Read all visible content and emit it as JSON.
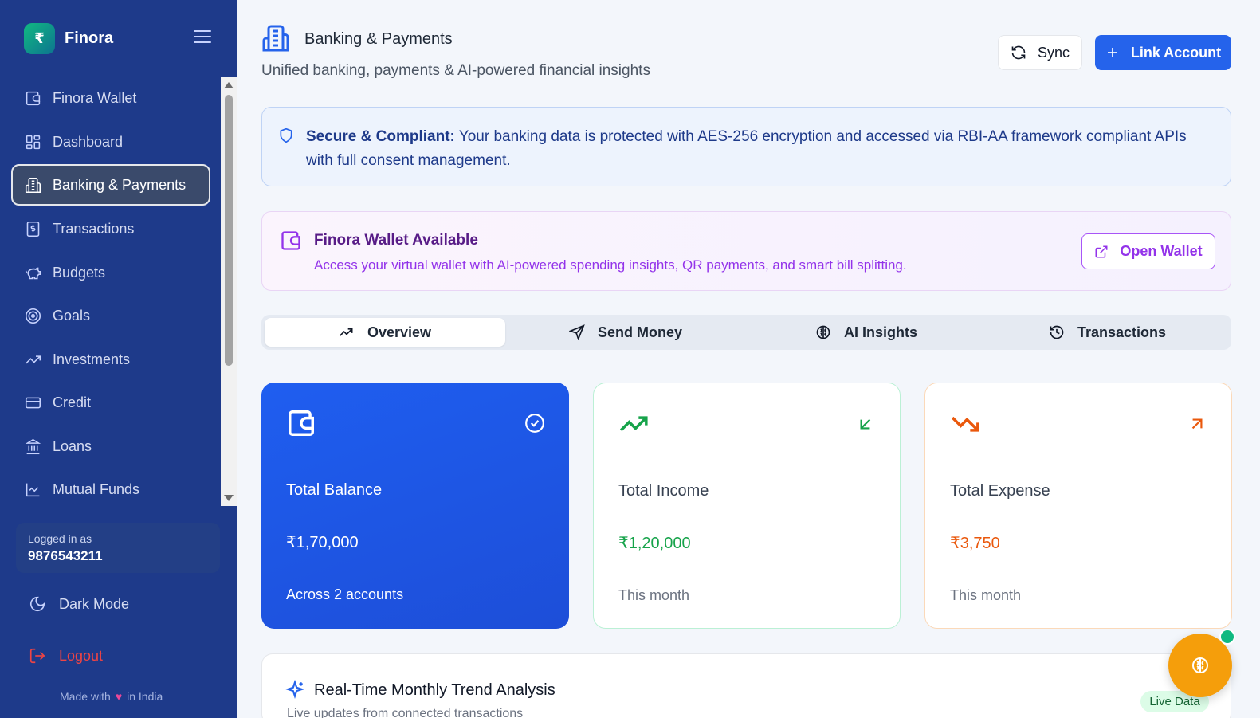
{
  "brand": {
    "logo_glyph": "₹",
    "name": "Finora"
  },
  "sidebar": {
    "items": [
      {
        "label": "Finora Wallet",
        "icon": "wallet-icon"
      },
      {
        "label": "Dashboard",
        "icon": "dashboard-icon"
      },
      {
        "label": "Banking & Payments",
        "icon": "bank-building-icon",
        "active": true
      },
      {
        "label": "Transactions",
        "icon": "receipt-icon"
      },
      {
        "label": "Budgets",
        "icon": "piggy-bank-icon"
      },
      {
        "label": "Goals",
        "icon": "target-icon"
      },
      {
        "label": "Investments",
        "icon": "trend-up-icon"
      },
      {
        "label": "Credit",
        "icon": "credit-card-icon"
      },
      {
        "label": "Loans",
        "icon": "landmark-icon"
      },
      {
        "label": "Mutual Funds",
        "icon": "line-chart-icon"
      }
    ],
    "user": {
      "label": "Logged in as",
      "phone": "9876543211"
    },
    "dark_mode_label": "Dark Mode",
    "logout_label": "Logout",
    "made_with_prefix": "Made with",
    "made_with_suffix": "in India"
  },
  "header": {
    "title": "Banking & Payments",
    "subtitle": "Unified banking, payments & AI-powered financial insights",
    "sync_label": "Sync",
    "link_account_label": "Link Account"
  },
  "secure_notice": {
    "bold": "Secure & Compliant:",
    "text": " Your banking data is protected with AES-256 encryption and accessed via RBI-AA framework compliant APIs with full consent management."
  },
  "wallet_banner": {
    "title": "Finora Wallet Available",
    "description": "Access your virtual wallet with AI-powered spending insights, QR payments, and smart bill splitting.",
    "button_label": "Open Wallet"
  },
  "tabs": [
    {
      "label": "Overview",
      "icon": "trend-zigzag-icon",
      "active": true
    },
    {
      "label": "Send Money",
      "icon": "send-icon"
    },
    {
      "label": "AI Insights",
      "icon": "brain-icon"
    },
    {
      "label": "Transactions",
      "icon": "history-icon"
    }
  ],
  "cards": {
    "balance": {
      "label": "Total Balance",
      "value": "₹1,70,000",
      "foot": "Across 2 accounts"
    },
    "income": {
      "label": "Total Income",
      "value": "₹1,20,000",
      "foot": "This month"
    },
    "expense": {
      "label": "Total Expense",
      "value": "₹3,750",
      "foot": "This month"
    }
  },
  "trend": {
    "title": "Real-Time Monthly Trend Analysis",
    "subtitle": "Live updates from connected transactions",
    "badge": "Live Data"
  },
  "colors": {
    "sidebar_bg": "#1e3a8a",
    "primary": "#2563eb",
    "income": "#16a34a",
    "expense": "#ea580c",
    "wallet_accent": "#9333ea",
    "fab": "#f59e0b"
  }
}
